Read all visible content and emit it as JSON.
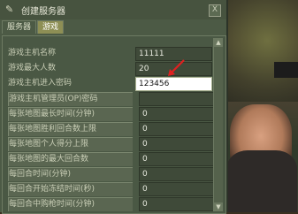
{
  "window": {
    "title": "创建服务器",
    "close": "X"
  },
  "tabs": [
    {
      "label": "服务器"
    },
    {
      "label": "游戏"
    }
  ],
  "settings": [
    {
      "label": "游戏主机名称",
      "value": "11111"
    },
    {
      "label": "游戏最大人数",
      "value": "20"
    },
    {
      "label": "游戏主机进入密码",
      "value": "123456"
    },
    {
      "label": "游戏主机管理员(OP)密码",
      "value": ""
    },
    {
      "label": "每张地图最长时间(分钟)",
      "value": "0"
    },
    {
      "label": "每张地图胜利回合数上限",
      "value": "0"
    },
    {
      "label": "每张地图个人得分上限",
      "value": "0"
    },
    {
      "label": "每张地图的最大回合数",
      "value": "0"
    },
    {
      "label": "每回合时间(分钟)",
      "value": "0"
    },
    {
      "label": "每回合开始冻结时间(秒)",
      "value": "0"
    },
    {
      "label": "每回合中购枪时间(分钟)",
      "value": "0"
    }
  ],
  "colors": {
    "annotation_arrow": "#e02020",
    "active_tab": "#8e8f55"
  }
}
